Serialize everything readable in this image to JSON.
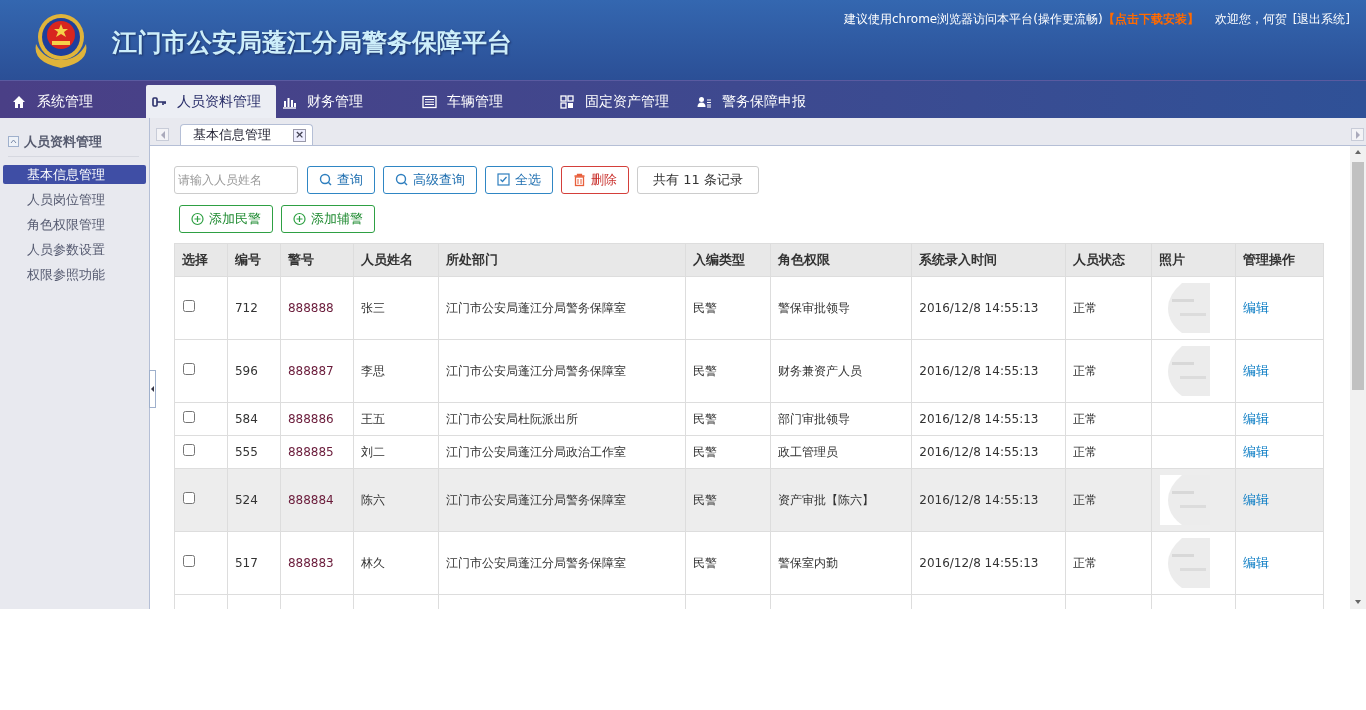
{
  "header": {
    "title": "江门市公安局蓬江分局警务保障平台",
    "notice": "建议使用chrome浏览器访问本平台(操作更流畅)",
    "download_link": "【点击下载安装】",
    "welcome": "欢迎您，何贺",
    "logout": "[退出系统]"
  },
  "nav": [
    {
      "label": "系统管理",
      "kind": "home",
      "selected": false
    },
    {
      "label": "人员资料管理",
      "kind": "key",
      "selected": true
    },
    {
      "label": "财务管理",
      "kind": "chart",
      "selected": false
    },
    {
      "label": "车辆管理",
      "kind": "list",
      "selected": false
    },
    {
      "label": "固定资产管理",
      "kind": "grid",
      "selected": false
    },
    {
      "label": "警务保障申报",
      "kind": "user",
      "selected": false
    }
  ],
  "sidebar": {
    "title": "人员资料管理",
    "items": [
      {
        "label": "基本信息管理",
        "selected": true
      },
      {
        "label": "人员岗位管理",
        "selected": false
      },
      {
        "label": "角色权限管理",
        "selected": false
      },
      {
        "label": "人员参数设置",
        "selected": false
      },
      {
        "label": "权限参照功能",
        "selected": false
      }
    ]
  },
  "tabs": [
    {
      "label": "基本信息管理",
      "selected": true,
      "close": "×"
    }
  ],
  "toolbar": {
    "search_placeholder": "请输入人员姓名",
    "buttons": [
      {
        "label": "查询",
        "kind": "search"
      },
      {
        "label": "高级查询",
        "kind": "search"
      },
      {
        "label": "全选",
        "kind": "check"
      },
      {
        "label": "删除",
        "kind": "delete"
      }
    ],
    "count": "共有 11 条记录",
    "add_buttons": [
      "添加民警",
      "添加辅警"
    ]
  },
  "table": {
    "columns": [
      "选择",
      "编号",
      "警号",
      "人员姓名",
      "所处部门",
      "入编类型",
      "角色权限",
      "系统录入时间",
      "人员状态",
      "照片",
      "管理操作"
    ],
    "rows": [
      {
        "checked": false,
        "id": "712",
        "badge": "888888",
        "name": "张三",
        "dept": "江门市公安局蓬江分局警务保障室",
        "type": "民警",
        "role": "警保审批领导",
        "time": "2016/12/8 14:55:13",
        "status": "正常",
        "photo": true,
        "highlighted": false,
        "action": "编辑"
      },
      {
        "checked": false,
        "id": "596",
        "badge": "888887",
        "name": "李思",
        "dept": "江门市公安局蓬江分局警务保障室",
        "type": "民警",
        "role": "财务兼资产人员",
        "time": "2016/12/8 14:55:13",
        "status": "正常",
        "photo": true,
        "highlighted": false,
        "action": "编辑"
      },
      {
        "checked": false,
        "id": "584",
        "badge": "888886",
        "name": "王五",
        "dept": "江门市公安局杜阮派出所",
        "type": "民警",
        "role": "部门审批领导",
        "time": "2016/12/8 14:55:13",
        "status": "正常",
        "photo": false,
        "highlighted": false,
        "action": "编辑"
      },
      {
        "checked": false,
        "id": "555",
        "badge": "888885",
        "name": "刘二",
        "dept": "江门市公安局蓬江分局政治工作室",
        "type": "民警",
        "role": "政工管理员",
        "time": "2016/12/8 14:55:13",
        "status": "正常",
        "photo": false,
        "highlighted": false,
        "action": "编辑"
      },
      {
        "checked": false,
        "id": "524",
        "badge": "888884",
        "name": "陈六",
        "dept": "江门市公安局蓬江分局警务保障室",
        "type": "民警",
        "role": "资产审批【陈六】",
        "time": "2016/12/8 14:55:13",
        "status": "正常",
        "photo": true,
        "highlighted": true,
        "action": "编辑"
      },
      {
        "checked": false,
        "id": "517",
        "badge": "888883",
        "name": "林久",
        "dept": "江门市公安局蓬江分局警务保障室",
        "type": "民警",
        "role": "警保室内勤",
        "time": "2016/12/8 14:55:13",
        "status": "正常",
        "photo": true,
        "highlighted": false,
        "action": "编辑"
      }
    ]
  }
}
